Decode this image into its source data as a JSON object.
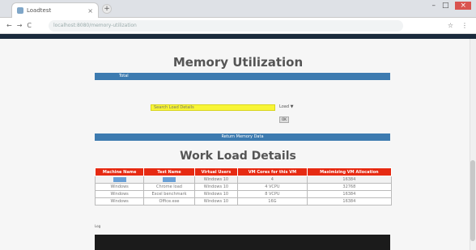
{
  "browser": {
    "tab_title": "Loadtest",
    "url": "localhost:8080/memory-utilization",
    "new_tab": "+",
    "tab_close": "×",
    "minimize": "–",
    "maximize": "□",
    "close": "×",
    "back": "←",
    "forward": "→",
    "reload": "C",
    "extensions": [
      "☆",
      "⋮"
    ]
  },
  "page": {
    "title": "Memory Utilization",
    "top_bar_text": "Total",
    "input_value": "Search Load Details",
    "dropdown_label": "Load ▼",
    "small_button": "OK",
    "action_bar_text": "Return Memory Data",
    "workload_title": "Work Load Details",
    "table": {
      "headers": [
        "Machine Name",
        "Test Name",
        "Virtual Users",
        "VM Cores for this VM",
        "Maximizing VM Allocation"
      ],
      "rows": [
        [
          "",
          "",
          "Windows 10",
          "4",
          "16384"
        ],
        [
          "Windows",
          "Chrome load",
          "Windows 10",
          "4 VCPU",
          "32768"
        ],
        [
          "Windows",
          "Excel benchmark",
          "Windows 10",
          "8 VCPU",
          "16384"
        ],
        [
          "Windows",
          "Office.exe",
          "Windows 10",
          "16G",
          "16384"
        ]
      ]
    },
    "footer_label": "Log"
  },
  "colors": {
    "accent_blue": "#3d7bb0",
    "header_red": "#e62a12",
    "input_yellow": "#f8f536"
  }
}
